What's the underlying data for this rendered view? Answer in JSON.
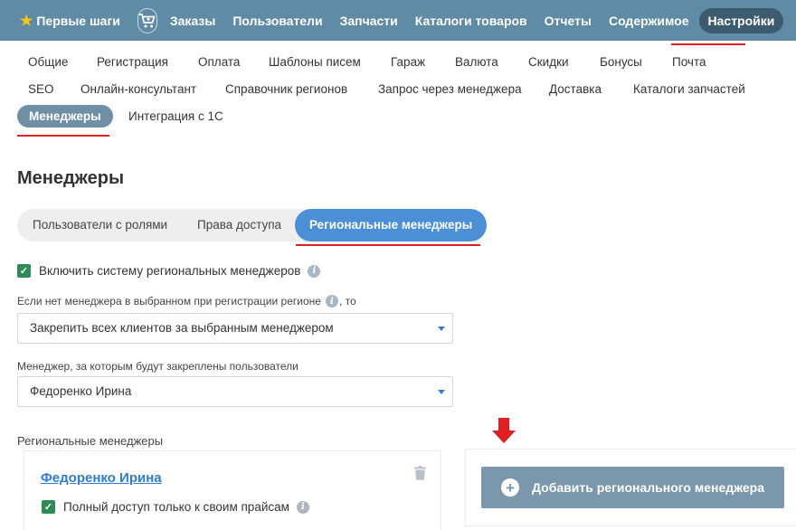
{
  "topnav": {
    "first_steps": "Первые шаги",
    "first_steps_icon": "star-icon",
    "cart_icon": "cart-icon",
    "items": [
      "Заказы",
      "Пользователи",
      "Запчасти",
      "Каталоги товаров",
      "Отчеты",
      "Содержимое"
    ],
    "active": "Настройки"
  },
  "subtabs": {
    "row1": [
      "Общие",
      "Регистрация",
      "Оплата",
      "Шаблоны писем",
      "Гараж",
      "Валюта",
      "Скидки",
      "Бонусы",
      "Почта"
    ],
    "row2": [
      "SEO",
      "Онлайн-консультант",
      "Справочник регионов",
      "Запрос через менеджера",
      "Доставка",
      "Каталоги запчастей"
    ],
    "row3_active": "Менеджеры",
    "row3": [
      "Интеграция с 1С"
    ]
  },
  "page": {
    "title": "Менеджеры"
  },
  "segments": {
    "items": [
      "Пользователи с ролями",
      "Права доступа"
    ],
    "active": "Региональные менеджеры"
  },
  "settings": {
    "enable_label": "Включить систему региональных менеджеров",
    "enable_checked": true,
    "no_manager_label_pre": "Если нет менеджера в выбранном при регистрации регионе",
    "no_manager_label_post": ", то",
    "no_manager_value": "Закрепить всех клиентов за выбранным менеджером",
    "assigned_manager_label": "Менеджер, за которым будут закреплены пользователи",
    "assigned_manager_value": "Федоренко Ирина"
  },
  "regional": {
    "section_label": "Региональные менеджеры",
    "card": {
      "name": "Федоренко Ирина",
      "permission_label": "Полный доступ только к своим прайсам",
      "permission_checked": true
    },
    "add_button": "Добавить регионального менеджера"
  },
  "colors": {
    "nav_bg": "#5f8ba4",
    "accent_blue": "#4b8fd6",
    "check_green": "#2e8b57",
    "highlight_red": "#e02020"
  }
}
